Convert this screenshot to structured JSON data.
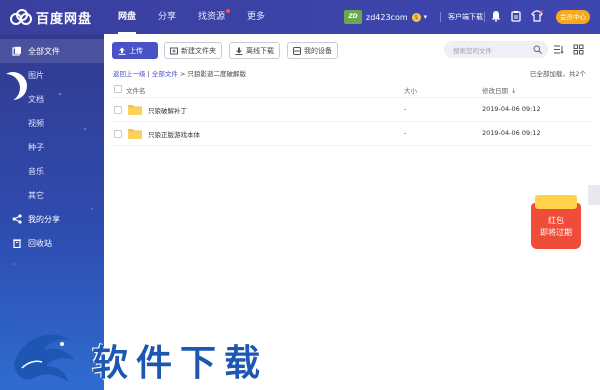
{
  "app": {
    "name": "百度网盘"
  },
  "nav": {
    "items": [
      "网盘",
      "分享",
      "找资源",
      "更多"
    ]
  },
  "user": {
    "avatar_text": "ZD",
    "username": "zd423com",
    "vip_badge": "$"
  },
  "header": {
    "client_download": "客户端下载",
    "member_center": "会员中心"
  },
  "sidebar": {
    "all_files": "全部文件",
    "categories": [
      "图片",
      "文档",
      "视频",
      "种子",
      "音乐",
      "其它"
    ],
    "my_share": "我的分享",
    "recycle_bin": "回收站"
  },
  "toolbar": {
    "upload": "上传",
    "new_folder": "新建文件夹",
    "offline_download": "离线下载",
    "my_devices": "我的设备",
    "search_placeholder": "搜索您的文件"
  },
  "breadcrumb": {
    "back": "返回上一级",
    "sep1": "|",
    "root": "全部文件",
    "arrow": ">",
    "current": "只狼影逝二度破解版"
  },
  "status": {
    "loaded_text": "已全部加载，共2个"
  },
  "table": {
    "headers": {
      "name": "文件名",
      "size": "大小",
      "date": "修改日期"
    },
    "rows": [
      {
        "name": "只狼破解补丁",
        "size": "-",
        "date": "2019-04-06 09:12"
      },
      {
        "name": "只狼正版游戏本体",
        "size": "-",
        "date": "2019-04-06 09:12"
      }
    ]
  },
  "redpack": {
    "line1": "红包",
    "line2": "即将过期"
  },
  "watermark": {
    "text": "软件下载"
  },
  "colors": {
    "header_bg": "#3b43a6",
    "primary": "#4a53c6",
    "member_btn": "#f7a91b",
    "redpack": "#f04c3a"
  }
}
